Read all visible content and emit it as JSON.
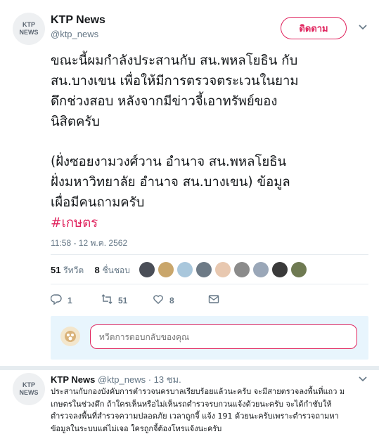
{
  "tweet": {
    "avatar_line1": "KTP",
    "avatar_line2": "NEWS",
    "display_name": "KTP News",
    "handle": "@ktp_news",
    "follow_label": "ติดตาม",
    "text_lines": [
      "ขณะนี้ผมกำลังประสานกับ สน.พหลโยธิน กับ",
      "สน.บางเขน เพื่อให้มีการตรวจตระเวนในยาม",
      "ดึกช่วงสอบ หลังจากมีข่าวจี้เอาทรัพย์ของ",
      "นิสิตครับ"
    ],
    "text_lines_2": [
      "(ฝั่งซอยงามวงศ์วาน อำนาจ สน.พหลโยธิน",
      "ฝั่งมหาวิทยาลัย อำนาจ สน.บางเขน) ข้อมูล",
      "เผื่อมีคนถามครับ"
    ],
    "hashtag": "#เกษตร",
    "timestamp": "11:58 - 12 พ.ค. 2562"
  },
  "stats": {
    "retweets_count": "51",
    "retweets_label": "รีทวีต",
    "likes_count": "8",
    "likes_label": "ชื่นชอบ",
    "face_colors": [
      "#4a4e57",
      "#c9a66b",
      "#a9c7dc",
      "#6d7a86",
      "#e8c8b0",
      "#8b8b8b",
      "#9aa7b8",
      "#3a3a3a",
      "#6f7a52"
    ]
  },
  "actions": {
    "reply_count": "1",
    "retweet_count": "51",
    "like_count": "8"
  },
  "reply_box": {
    "placeholder": "ทวีตการตอบกลับของคุณ"
  },
  "reply_tweet": {
    "avatar_line1": "KTP",
    "avatar_line2": "NEWS",
    "display_name": "KTP News",
    "meta": "@ktp_news · 13 ชม.",
    "text_lines": [
      "ประสานกับกองบังคับการตำรวจนครบาลเรียบร้อยแล้วนะครับ จะมีสายตรวจลงพื้นที่แถว ม",
      "เกษตรในช่วงดึก ถ้าใครเห็นหรือไม่เห็นรถตำรวจรบกวนแจ้งด้วยนะครับ จะได้กำชับให้",
      "ตำรวจลงพื้นที่สำรวจความปลอดภัย เวลาถูกจี้ แจ้ง 191 ด้วยนะครับเพราะตำรวจถามหา",
      "ข้อมูลในระบบแต่ไม่เจอ ใครถูกจี้ต้องโทรแจ้งนะครับ"
    ]
  }
}
